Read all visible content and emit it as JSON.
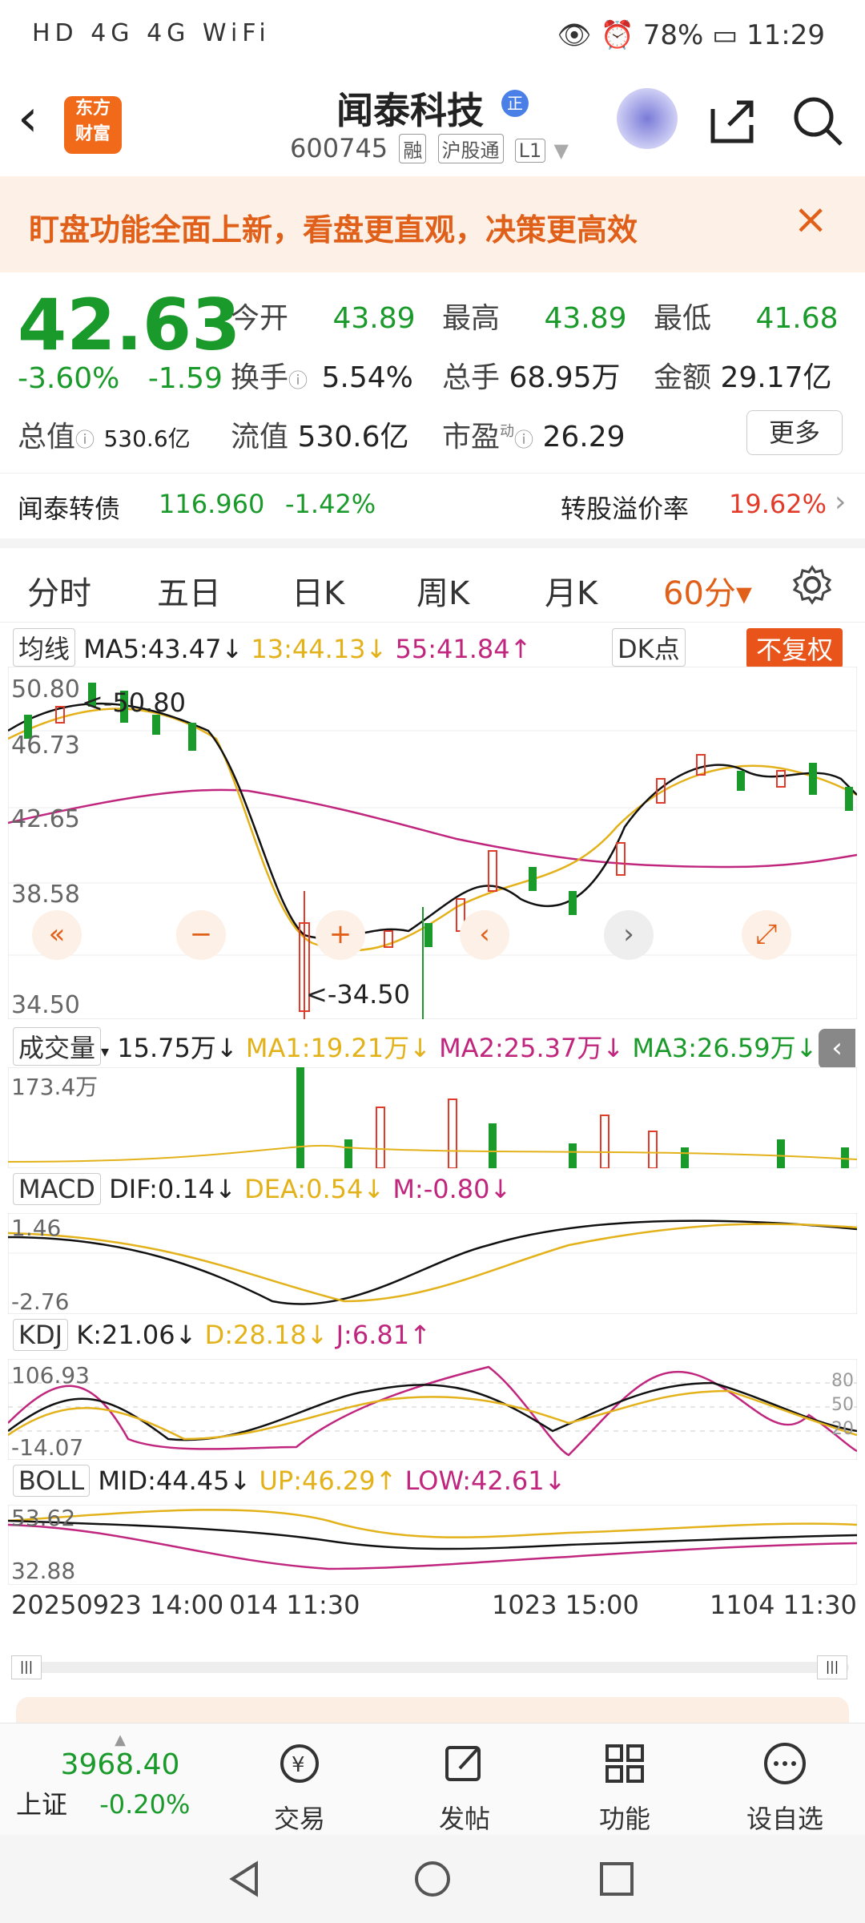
{
  "status_bar": {
    "left_icons": "HD 4G 4G WiFi",
    "battery": "78%",
    "time": "11:29"
  },
  "header": {
    "logo_text_line1": "东方",
    "logo_text_line2": "财富",
    "title": "闻泰科技",
    "title_badge": "正",
    "code": "600745",
    "tag_rong": "融",
    "tag_hgt": "沪股通",
    "tag_level": "L1"
  },
  "banner": {
    "text": "盯盘功能全面上新，看盘更直观，决策更高效",
    "close": "×"
  },
  "quote": {
    "price": "42.63",
    "change_pct": "-3.60%",
    "change_abs": "-1.59",
    "open_label": "今开",
    "open": "43.89",
    "high_label": "最高",
    "high": "43.89",
    "low_label": "最低",
    "low": "41.68",
    "turnover_label": "换手",
    "turnover": "5.54%",
    "vol_label": "总手",
    "vol": "68.95万",
    "amount_label": "金额",
    "amount": "29.17亿",
    "mktcap_label": "总值",
    "mktcap": "530.6亿",
    "float_label": "流值",
    "float": "530.6亿",
    "pe_label": "市盈",
    "pe_sup": "动",
    "pe": "26.29",
    "more": "更多"
  },
  "bond": {
    "name": "闻泰转债",
    "price": "116.960",
    "pct": "-1.42%",
    "premium_label": "转股溢价率",
    "premium": "19.62%"
  },
  "tabs": [
    "分时",
    "五日",
    "日K",
    "周K",
    "月K",
    "60分▾"
  ],
  "chart": {
    "ma_label": "均线",
    "ma5": "MA5:43.47",
    "ma_arrow1": "↓",
    "ma13": "13:44.13",
    "ma_arrow2": "↓",
    "ma55": "55:41.84",
    "ma_arrow3": "↑",
    "dk": "DK点",
    "fuquan": "不复权",
    "yticks": [
      "50.80",
      "46.73",
      "42.65",
      "38.58",
      "34.50"
    ],
    "high_mark": "<-50.80",
    "low_mark": "<-34.50",
    "vol_label": "成交量",
    "vol_val": "15.75万",
    "vol_ma1": "MA1:19.21万",
    "vol_ma2": "MA2:25.37万",
    "vol_ma3": "MA3:26.59万",
    "vol_max": "173.4万",
    "macd_label": "MACD",
    "dif": "DIF:0.14",
    "dea": "DEA:0.54",
    "m": "M:-0.80",
    "macd_hi": "1.46",
    "macd_lo": "-2.76",
    "kdj_label": "KDJ",
    "k": "K:21.06",
    "d": "D:28.18",
    "j": "J:6.81",
    "kdj_hi": "106.93",
    "kdj_lo": "-14.07",
    "kdj_r1": "80",
    "kdj_r2": "50",
    "kdj_r3": "20",
    "boll_label": "BOLL",
    "mid": "MID:44.45",
    "up": "UP:46.29",
    "low": "LOW:42.61",
    "boll_hi": "53.62",
    "boll_lo": "32.88",
    "x_labels": [
      "20250923 14:00",
      "014 11:30",
      "1023 15:00",
      "1104 11:30"
    ]
  },
  "bottom": {
    "index_value": "3968.40",
    "index_name": "上证",
    "index_pct": "-0.20%",
    "items": [
      "交易",
      "发帖",
      "功能",
      "设自选"
    ]
  },
  "colors": {
    "accent": "#e0601a",
    "down": "#1a9a2a",
    "up": "#e23b2a",
    "ma5": "#111111",
    "ma13": "#e3b21a",
    "ma55": "#c0267e"
  },
  "chart_data": {
    "type": "candlestick",
    "ylim": [
      34.5,
      50.8
    ],
    "ma_legend": [
      "MA5",
      "13",
      "55"
    ]
  }
}
